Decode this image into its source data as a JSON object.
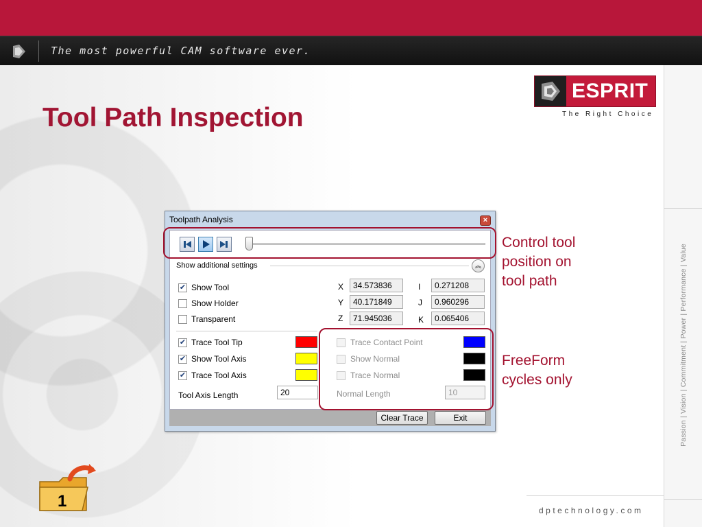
{
  "header": {
    "slogan": "The most powerful CAM software ever."
  },
  "slide": {
    "title": "Tool Path Inspection"
  },
  "logo": {
    "brand": "ESPRIT",
    "tagline": "The Right Choice"
  },
  "sidebar_text": "Passion | Vision | Commitment | Power | Performance | Value",
  "footer_url": "dptechnology.com",
  "folder_badge": "1",
  "dialog": {
    "title": "Toolpath Analysis",
    "close_glyph": "×",
    "section_label": "Show additional settings",
    "collapse_glyph": "︽",
    "show_tool": "Show Tool",
    "show_holder": "Show Holder",
    "transparent": "Transparent",
    "trace_tool_tip": "Trace Tool Tip",
    "show_tool_axis": "Show Tool Axis",
    "trace_tool_axis": "Trace Tool Axis",
    "tool_axis_length_label": "Tool Axis Length",
    "tool_axis_length": "20",
    "trace_contact_point": "Trace Contact Point",
    "show_normal": "Show Normal",
    "trace_normal": "Trace Normal",
    "normal_length_label": "Normal Length",
    "normal_length": "10",
    "coords": {
      "x_label": "X",
      "x": "34.573836",
      "y_label": "Y",
      "y": "40.171849",
      "z_label": "Z",
      "z": "71.945036",
      "i_label": "I",
      "i": "0.271208",
      "j_label": "J",
      "j": "0.960296",
      "k_label": "K",
      "k": "0.065406"
    },
    "clear_trace": "Clear Trace",
    "exit": "Exit",
    "checked_glyph": "✔",
    "colors": {
      "trace_tool_tip": "#ff0000",
      "show_tool_axis": "#ffff00",
      "trace_tool_axis": "#ffff00",
      "trace_contact_point": "#0000ff",
      "show_normal": "#000000",
      "trace_normal": "#000000"
    }
  },
  "callouts": {
    "control_line1": "Control tool",
    "control_line2": "position on",
    "control_line3": "tool path",
    "freeform_line1": "FreeForm",
    "freeform_line2": "cycles only"
  },
  "brand_colors": {
    "primary_red": "#b8173a",
    "callout_red": "#a3122f"
  }
}
